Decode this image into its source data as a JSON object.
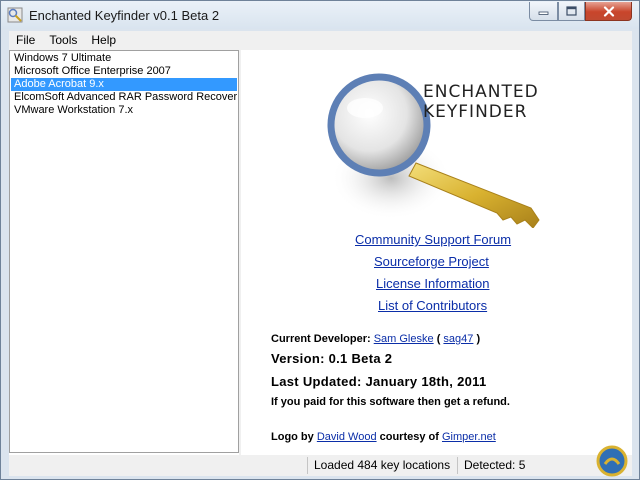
{
  "window": {
    "title": "Enchanted Keyfinder v0.1 Beta 2",
    "app_icon": "keyfinder-app-icon"
  },
  "menubar": {
    "items": [
      {
        "label": "File"
      },
      {
        "label": "Tools"
      },
      {
        "label": "Help"
      }
    ]
  },
  "product_list": {
    "items": [
      {
        "label": "Windows 7 Ultimate"
      },
      {
        "label": "Microsoft Office Enterprise 2007"
      },
      {
        "label": "Adobe Acrobat 9.x",
        "selected": true
      },
      {
        "label": "ElcomSoft Advanced RAR Password Recovery"
      },
      {
        "label": "VMware Workstation 7.x"
      }
    ]
  },
  "about": {
    "logo": {
      "line1": "ENCHANTED",
      "line2": "KEYFINDER"
    },
    "links": {
      "forum": "Community Support Forum",
      "sourceforge": "Sourceforge Project",
      "license": "License Information",
      "contributors": "List of Contributors"
    },
    "developer": {
      "label": "Current Developer:",
      "name": "Sam Gleske",
      "open_paren": "(",
      "handle": "sag47",
      "close_paren": ")"
    },
    "version": "Version: 0.1 Beta 2",
    "last_updated": "Last Updated: January 18th, 2011",
    "refund_note": "If you paid for this software then get a refund.",
    "logo_credit": {
      "prefix": "Logo by",
      "author": "David Wood",
      "middle": "courtesy of",
      "site": "Gimper.net"
    }
  },
  "statusbar": {
    "loaded": "Loaded 484 key locations",
    "detected": "Detected: 5"
  },
  "colors": {
    "selection": "#3399ff",
    "link": "#0b2ea8",
    "close_button": "#c9452b",
    "key_gold": "#d9b230"
  }
}
